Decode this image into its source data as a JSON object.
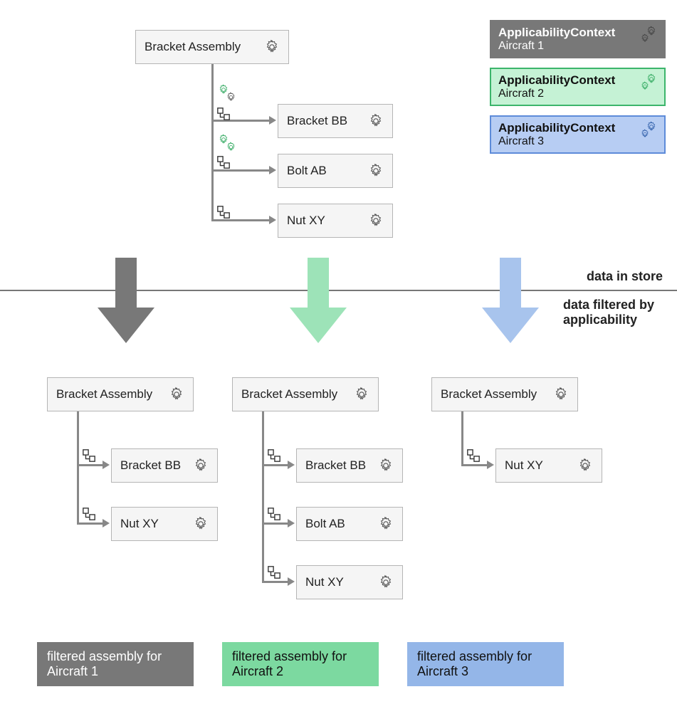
{
  "top_tree": {
    "root": "Bracket Assembly",
    "children": [
      "Bracket BB",
      "Bolt AB",
      "Nut XY"
    ]
  },
  "contexts": [
    {
      "title": "ApplicabilityContext",
      "sub": "Aircraft 1"
    },
    {
      "title": "ApplicabilityContext",
      "sub": "Aircraft 2"
    },
    {
      "title": "ApplicabilityContext",
      "sub": "Aircraft 3"
    }
  ],
  "divider": {
    "above": "data in store",
    "below": "data filtered by applicability"
  },
  "filtered": [
    {
      "root": "Bracket Assembly",
      "children": [
        "Bracket BB",
        "Nut XY"
      ],
      "caption": "filtered assembly for Aircraft 1"
    },
    {
      "root": "Bracket Assembly",
      "children": [
        "Bracket BB",
        "Bolt AB",
        "Nut XY"
      ],
      "caption": "filtered assembly for Aircraft 2"
    },
    {
      "root": "Bracket Assembly",
      "children": [
        "Nut XY"
      ],
      "caption": "filtered assembly for Aircraft 3"
    }
  ]
}
